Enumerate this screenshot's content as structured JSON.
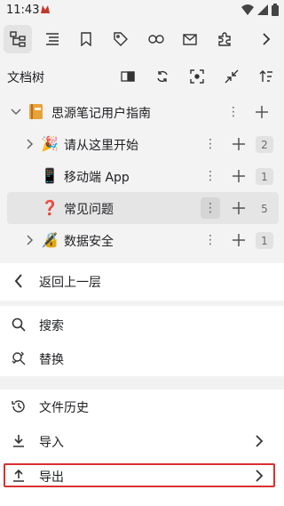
{
  "status_bar": {
    "time": "11:43"
  },
  "toolbar": {
    "buttons": [
      {
        "icon": "file-tree-icon"
      },
      {
        "icon": "outline-icon"
      },
      {
        "icon": "bookmark-icon"
      },
      {
        "icon": "tag-icon"
      },
      {
        "icon": "link-icon"
      },
      {
        "icon": "inbox-icon"
      },
      {
        "icon": "plugin-icon"
      },
      {
        "icon": "chevron-right-icon"
      }
    ]
  },
  "dock": {
    "title": "文档树"
  },
  "tree": {
    "notebook": {
      "icon": "notebook-icon",
      "label": "思源笔记用户指南"
    },
    "docs": [
      {
        "emoji": "🎉",
        "label": "请从这里开始",
        "count": "2",
        "expandable": true
      },
      {
        "emoji": "📱",
        "label": "移动端 App",
        "count": "1",
        "expandable": false
      },
      {
        "emoji": "❓",
        "label": "常见问题",
        "count": "5",
        "expandable": false,
        "selected": true
      },
      {
        "emoji": "🔏",
        "label": "数据安全",
        "count": "1",
        "expandable": true
      }
    ]
  },
  "menu": {
    "back": "返回上一层",
    "search": "搜索",
    "replace": "替换",
    "history": "文件历史",
    "import": "导入",
    "export": "导出"
  },
  "colors": {
    "panel_bg": "#f3f3f3",
    "highlight_border": "#d93030",
    "notebook_icon": "#e8a23a"
  }
}
